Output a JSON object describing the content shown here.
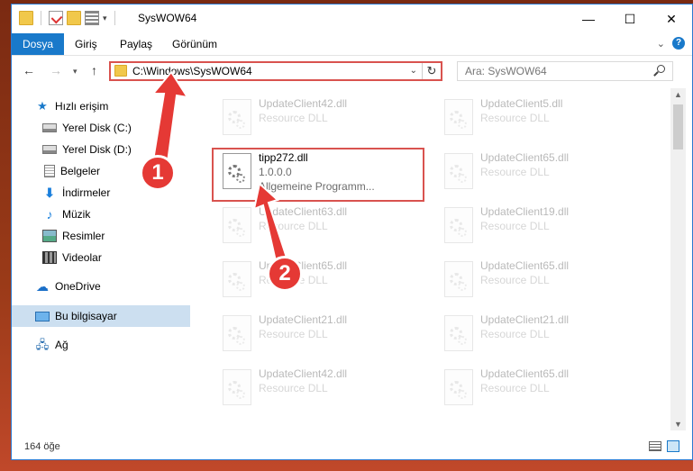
{
  "window": {
    "title": "SysWOW64",
    "minimize": "—",
    "maximize": "☐",
    "close": "✕"
  },
  "ribbon": {
    "tabs": [
      {
        "label": "Dosya"
      },
      {
        "label": "Giriş"
      },
      {
        "label": "Paylaş"
      },
      {
        "label": "Görünüm"
      }
    ],
    "expand": "⌄",
    "help": "?"
  },
  "navigation": {
    "back": "←",
    "forward": "→",
    "recent": "▾",
    "up": "↑",
    "address": "C:\\Windows\\SysWOW64",
    "address_dropdown": "⌄",
    "refresh": "↻",
    "search_placeholder": "Ara: SysWOW64"
  },
  "sidebar": {
    "quick_access": "Hızlı erişim",
    "items": [
      {
        "label": "Yerel Disk (C:)",
        "pinned": true
      },
      {
        "label": "Yerel Disk (D:)",
        "pinned": true
      },
      {
        "label": "Belgeler",
        "pinned": true
      },
      {
        "label": "İndirmeler",
        "pinned": true
      },
      {
        "label": "Müzik",
        "pinned": true
      },
      {
        "label": "Resimler",
        "pinned": true
      },
      {
        "label": "Videolar",
        "pinned": true
      }
    ],
    "onedrive": "OneDrive",
    "this_pc": "Bu bilgisayar",
    "network": "Ağ"
  },
  "files": {
    "left": [
      {
        "name": "UpdateClient42.dll",
        "desc": "Resource DLL"
      },
      {
        "name": "tipp272.dll",
        "desc": "1.0.0.0",
        "desc2": "Allgemeine Programm..."
      },
      {
        "name": "UpdateClient63.dll",
        "desc": "Resource DLL"
      },
      {
        "name": "UpdateClient65.dll",
        "desc": "Resource DLL"
      },
      {
        "name": "UpdateClient21.dll",
        "desc": "Resource DLL"
      },
      {
        "name": "UpdateClient42.dll",
        "desc": "Resource DLL"
      }
    ],
    "right": [
      {
        "name": "UpdateClient5.dll",
        "desc": "Resource DLL"
      },
      {
        "name": "UpdateClient65.dll",
        "desc": "Resource DLL"
      },
      {
        "name": "UpdateClient19.dll",
        "desc": "Resource DLL"
      },
      {
        "name": "UpdateClient65.dll",
        "desc": "Resource DLL"
      },
      {
        "name": "UpdateClient21.dll",
        "desc": "Resource DLL"
      },
      {
        "name": "UpdateClient65.dll",
        "desc": "Resource DLL"
      }
    ]
  },
  "status": {
    "count": "164 öğe"
  },
  "annotations": {
    "step1": "1",
    "step2": "2",
    "color": "#e53935"
  },
  "colors": {
    "accent": "#1979ca",
    "highlight_border": "#d9534f",
    "selected_bg": "#ccdff0"
  }
}
